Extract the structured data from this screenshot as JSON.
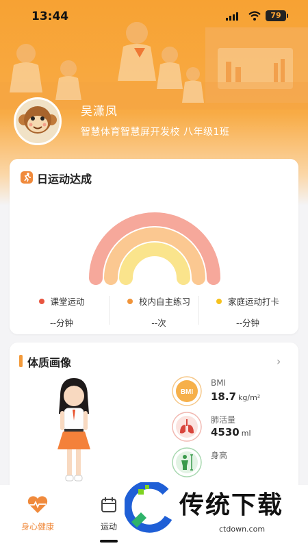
{
  "status_bar": {
    "time": "13:44",
    "battery": "79"
  },
  "profile": {
    "name": "吴潇凤",
    "school": "智慧体育智慧屏开发校 八年级1班"
  },
  "daily": {
    "title": "日运动达成",
    "legend": [
      {
        "label": "课堂运动",
        "value": "--分钟",
        "color": "#e8553f"
      },
      {
        "label": "校内自主练习",
        "value": "--次",
        "color": "#f0943a"
      },
      {
        "label": "家庭运动打卡",
        "value": "--分钟",
        "color": "#f6c21e"
      }
    ],
    "colors": {
      "outer": "#f6a89b",
      "middle": "#fbc891",
      "inner": "#fae48c"
    }
  },
  "physique": {
    "title": "体质画像",
    "metrics": [
      {
        "name": "BMI",
        "value": "18.7",
        "unit": "kg/m²",
        "icon": "bmi-icon"
      },
      {
        "name": "肺活量",
        "value": "4530",
        "unit": "ml",
        "icon": "lungs-icon"
      },
      {
        "name": "身高",
        "icon": "height-icon"
      }
    ]
  },
  "nav": {
    "items": [
      {
        "label": "身心健康",
        "icon": "heart-pulse-icon",
        "active": true
      },
      {
        "label": "运动",
        "icon": "calendar-icon",
        "active": false
      }
    ]
  },
  "watermark": {
    "text": "传统下载",
    "url": "ctdown.com"
  },
  "colors": {
    "brand": "#f7a233",
    "active": "#f08a3c"
  }
}
